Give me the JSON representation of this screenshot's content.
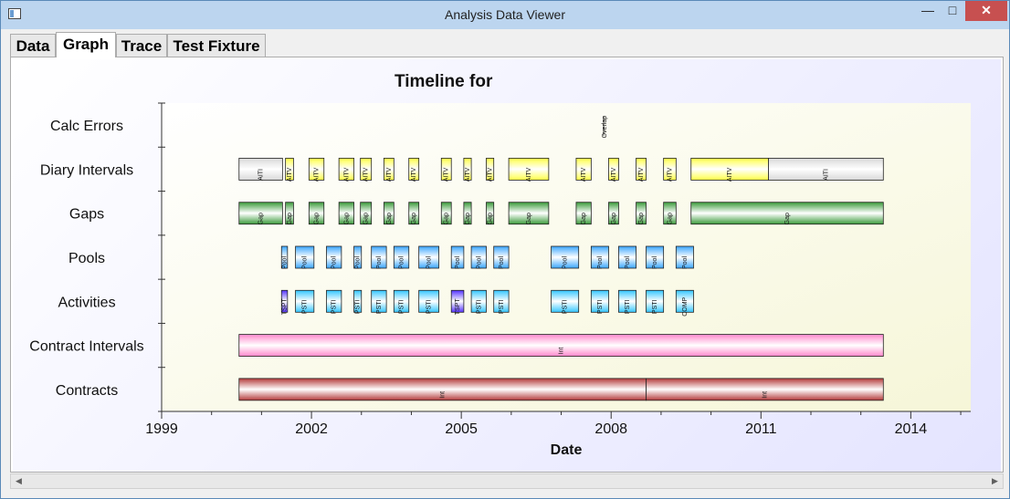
{
  "window": {
    "title": "Analysis Data Viewer",
    "minimize_icon": "minimize-icon",
    "maximize_icon": "maximize-icon",
    "close_icon": "close-icon"
  },
  "tabs": [
    {
      "label": "Data",
      "active": false
    },
    {
      "label": "Graph",
      "active": true
    },
    {
      "label": "Trace",
      "active": false
    },
    {
      "label": "Test Fixture",
      "active": false
    }
  ],
  "scrollbar": {
    "left_icon": "scroll-left-icon",
    "right_icon": "scroll-right-icon"
  },
  "colors": {
    "diary": "#ffff44",
    "diary_alt": "#d8d8d8",
    "gap": "#3a9a3a",
    "pool": "#3aa6ff",
    "activity": "#33c6ff",
    "activity_alt": "#5533ff",
    "contract_interval": "#ff88cc",
    "contract": "#b33a3a",
    "overlap": "#555555"
  },
  "chart_data": {
    "type": "timeline",
    "title": "Timeline for",
    "xlabel": "Date",
    "xlim": [
      1999.0,
      2015.2
    ],
    "xticks": [
      "1999",
      "2002",
      "2005",
      "2008",
      "2011",
      "2014"
    ],
    "grid": false,
    "categories": [
      "Calc Errors",
      "Diary Intervals",
      "Gaps",
      "Pools",
      "Activities",
      "Contract Intervals",
      "Contracts"
    ],
    "series": [
      {
        "category": "Calc Errors",
        "items": [
          {
            "start": 2007.85,
            "end": 2007.86,
            "label": "Overlap",
            "kind": "marker"
          }
        ]
      },
      {
        "category": "Diary Intervals",
        "items": [
          {
            "start": 2000.55,
            "end": 2001.42,
            "label": "AITI",
            "kind": "alt"
          },
          {
            "start": 2001.48,
            "end": 2001.64,
            "label": "AITV",
            "kind": "main"
          },
          {
            "start": 2001.95,
            "end": 2002.25,
            "label": "AITV",
            "kind": "main"
          },
          {
            "start": 2002.55,
            "end": 2002.85,
            "label": "AITV",
            "kind": "main"
          },
          {
            "start": 2002.98,
            "end": 2003.2,
            "label": "AITV",
            "kind": "main"
          },
          {
            "start": 2003.45,
            "end": 2003.65,
            "label": "AITV",
            "kind": "main"
          },
          {
            "start": 2003.95,
            "end": 2004.15,
            "label": "AITV",
            "kind": "main"
          },
          {
            "start": 2004.6,
            "end": 2004.8,
            "label": "AITV",
            "kind": "main"
          },
          {
            "start": 2005.05,
            "end": 2005.2,
            "label": "AITV",
            "kind": "main"
          },
          {
            "start": 2005.5,
            "end": 2005.65,
            "label": "AITV",
            "kind": "main"
          },
          {
            "start": 2005.95,
            "end": 2006.75,
            "label": "AITV",
            "kind": "main"
          },
          {
            "start": 2007.3,
            "end": 2007.6,
            "label": "AITV",
            "kind": "main"
          },
          {
            "start": 2007.95,
            "end": 2008.15,
            "label": "AITV",
            "kind": "main"
          },
          {
            "start": 2008.5,
            "end": 2008.7,
            "label": "AITV",
            "kind": "main"
          },
          {
            "start": 2009.05,
            "end": 2009.3,
            "label": "AITV",
            "kind": "main"
          },
          {
            "start": 2009.6,
            "end": 2011.15,
            "label": "AITV",
            "kind": "main"
          },
          {
            "start": 2011.15,
            "end": 2013.45,
            "label": "AITI",
            "kind": "alt"
          }
        ]
      },
      {
        "category": "Gaps",
        "items": [
          {
            "start": 2000.55,
            "end": 2001.42,
            "label": "Gap"
          },
          {
            "start": 2001.48,
            "end": 2001.64,
            "label": "Gap"
          },
          {
            "start": 2001.95,
            "end": 2002.25,
            "label": "Gap"
          },
          {
            "start": 2002.55,
            "end": 2002.85,
            "label": "Gap"
          },
          {
            "start": 2002.98,
            "end": 2003.2,
            "label": "Gap"
          },
          {
            "start": 2003.45,
            "end": 2003.65,
            "label": "Gap"
          },
          {
            "start": 2003.95,
            "end": 2004.15,
            "label": "Gap"
          },
          {
            "start": 2004.6,
            "end": 2004.8,
            "label": "Gap"
          },
          {
            "start": 2005.05,
            "end": 2005.2,
            "label": "Gap"
          },
          {
            "start": 2005.5,
            "end": 2005.65,
            "label": "Gap"
          },
          {
            "start": 2005.95,
            "end": 2006.75,
            "label": "Gap"
          },
          {
            "start": 2007.3,
            "end": 2007.6,
            "label": "Gap"
          },
          {
            "start": 2007.95,
            "end": 2008.15,
            "label": "Gap"
          },
          {
            "start": 2008.5,
            "end": 2008.7,
            "label": "Gap"
          },
          {
            "start": 2009.05,
            "end": 2009.3,
            "label": "Gap"
          },
          {
            "start": 2009.6,
            "end": 2013.45,
            "label": "Gap"
          }
        ]
      },
      {
        "category": "Pools",
        "items": [
          {
            "start": 2001.4,
            "end": 2001.52,
            "label": "Pool"
          },
          {
            "start": 2001.68,
            "end": 2002.05,
            "label": "Pool"
          },
          {
            "start": 2002.3,
            "end": 2002.6,
            "label": "Pool"
          },
          {
            "start": 2002.85,
            "end": 2003.0,
            "label": "Pool"
          },
          {
            "start": 2003.2,
            "end": 2003.5,
            "label": "Pool"
          },
          {
            "start": 2003.65,
            "end": 2003.95,
            "label": "Pool"
          },
          {
            "start": 2004.15,
            "end": 2004.55,
            "label": "Pool"
          },
          {
            "start": 2004.8,
            "end": 2005.05,
            "label": "Pool"
          },
          {
            "start": 2005.2,
            "end": 2005.5,
            "label": "Pool"
          },
          {
            "start": 2005.65,
            "end": 2005.95,
            "label": "Pool"
          },
          {
            "start": 2006.8,
            "end": 2007.35,
            "label": "Pool"
          },
          {
            "start": 2007.6,
            "end": 2007.95,
            "label": "Pool"
          },
          {
            "start": 2008.15,
            "end": 2008.5,
            "label": "Pool"
          },
          {
            "start": 2008.7,
            "end": 2009.05,
            "label": "Pool"
          },
          {
            "start": 2009.3,
            "end": 2009.65,
            "label": "Pool"
          }
        ]
      },
      {
        "category": "Activities",
        "items": [
          {
            "start": 2001.4,
            "end": 2001.52,
            "label": "TSPT",
            "kind": "alt"
          },
          {
            "start": 2001.68,
            "end": 2002.05,
            "label": "PSTI",
            "kind": "main"
          },
          {
            "start": 2002.3,
            "end": 2002.6,
            "label": "PSTI",
            "kind": "main"
          },
          {
            "start": 2002.85,
            "end": 2003.0,
            "label": "PSTI",
            "kind": "main"
          },
          {
            "start": 2003.2,
            "end": 2003.5,
            "label": "PSTI",
            "kind": "main"
          },
          {
            "start": 2003.65,
            "end": 2003.95,
            "label": "PSTI",
            "kind": "main"
          },
          {
            "start": 2004.15,
            "end": 2004.55,
            "label": "PSTI",
            "kind": "main"
          },
          {
            "start": 2004.8,
            "end": 2005.05,
            "label": "TSPT",
            "kind": "alt"
          },
          {
            "start": 2005.2,
            "end": 2005.5,
            "label": "PSTI",
            "kind": "main"
          },
          {
            "start": 2005.65,
            "end": 2005.95,
            "label": "PSTI",
            "kind": "main"
          },
          {
            "start": 2006.8,
            "end": 2007.35,
            "label": "PSTI",
            "kind": "main"
          },
          {
            "start": 2007.6,
            "end": 2007.95,
            "label": "PSTI",
            "kind": "main"
          },
          {
            "start": 2008.15,
            "end": 2008.5,
            "label": "PSTI",
            "kind": "main"
          },
          {
            "start": 2008.7,
            "end": 2009.05,
            "label": "PSTI",
            "kind": "main"
          },
          {
            "start": 2009.3,
            "end": 2009.65,
            "label": "COMP",
            "kind": "main"
          }
        ]
      },
      {
        "category": "Contract Intervals",
        "items": [
          {
            "start": 2000.55,
            "end": 2013.45,
            "label": "Int"
          }
        ]
      },
      {
        "category": "Contracts",
        "items": [
          {
            "start": 2000.55,
            "end": 2008.7,
            "label": "Int"
          },
          {
            "start": 2008.7,
            "end": 2013.45,
            "label": "Int"
          }
        ]
      }
    ]
  }
}
